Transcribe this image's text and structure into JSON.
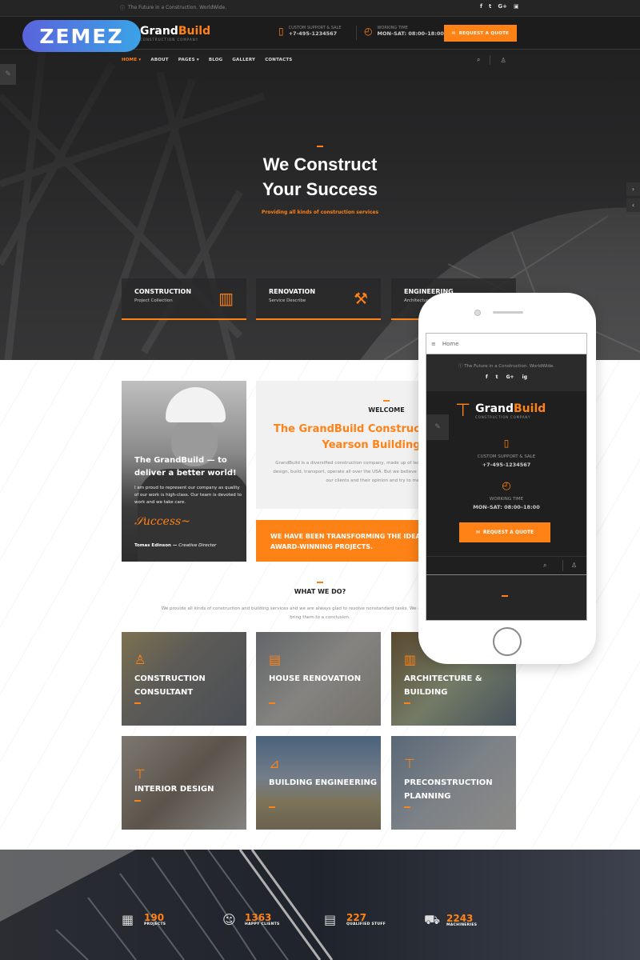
{
  "topbar": {
    "slogan": "The Future in a Construction. WorldWide.",
    "social": [
      "f",
      "t",
      "G+",
      "ig"
    ]
  },
  "brand": {
    "zemez": "ZEMEZ",
    "name_part1": "Grand",
    "name_part2": "Build",
    "subtitle": "CONSTRUCTION COMPANY"
  },
  "header": {
    "support_label": "CUSTOM SUPPORT & SALE",
    "support_value": "+7-495-1234567",
    "hours_label": "WORKING TIME",
    "hours_value": "MON–SAT: 08:00–18:00",
    "quote_button": "REQUEST A QUOTE"
  },
  "nav": {
    "items": [
      {
        "label": "HOME ▾",
        "active": true
      },
      {
        "label": "ABOUT",
        "active": false
      },
      {
        "label": "PAGES ▾",
        "active": false
      },
      {
        "label": "BLOG",
        "active": false
      },
      {
        "label": "GALLERY",
        "active": false
      },
      {
        "label": "CONTACTS",
        "active": false
      }
    ]
  },
  "hero": {
    "title_line1": "We Construct",
    "title_line2": "Your Success",
    "subtitle": "Providing all kinds of construction services",
    "features": [
      {
        "title": "CONSTRUCTION",
        "subtitle": "Project Collection",
        "icon": "building-icon"
      },
      {
        "title": "RENOVATION",
        "subtitle": "Service Describe",
        "icon": "tools-icon"
      },
      {
        "title": "ENGINEERING",
        "subtitle": "Architecture",
        "icon": "engineering-icon"
      }
    ]
  },
  "about": {
    "heading": "The GrandBuild — to deliver a better world!",
    "text": "I am proud to represent our company as quality of our work is high-class. Our team is devoted to work and we take care.",
    "signature": "Signature",
    "author_name": "Tomas Edinson",
    "author_role": "Creative Director"
  },
  "welcome": {
    "label": "WELCOME",
    "heading": "The GrandBuild Construction Company & Yearson Building Market",
    "text": "GrandBuild is a diversified construction company, made up of leaders in their industries. All working to design, build, transport, operate all over the USA. But we believe that projects are about more than that: our clients and their opinion and try to meet their needs.",
    "banner": "WE HAVE BEEN TRANSFORMING THE IDEAS & VISIONS INTO AWARD-WINNING PROJECTS."
  },
  "what_we_do": {
    "title": "WHAT WE DO?",
    "text": "We provide all kinds of construction and building services and we are always glad to resolve nonstandard tasks. We always take challenges and bring them to a conclusion.",
    "services": [
      {
        "title": "CONSTRUCTION CONSULTANT",
        "icon": "person-icon"
      },
      {
        "title": "HOUSE RENOVATION",
        "icon": "brick-icon"
      },
      {
        "title": "ARCHITECTURE & BUILDING",
        "icon": "building-icon"
      },
      {
        "title": "INTERIOR DESIGN",
        "icon": "paint-roller-icon"
      },
      {
        "title": "BUILDING ENGINEERING",
        "icon": "ruler-triangle-icon"
      },
      {
        "title": "PRECONSTRUCTION PLANNING",
        "icon": "t-square-icon"
      }
    ]
  },
  "stats": [
    {
      "value": "190",
      "label": "PROJECTS",
      "icon": "buildings-icon"
    },
    {
      "value": "1363",
      "label": "HAPPY CLIENTS",
      "icon": "users-icon"
    },
    {
      "value": "227",
      "label": "QUALIFIED STUFF",
      "icon": "certificate-icon"
    },
    {
      "value": "2243",
      "label": "MACHINERIES",
      "icon": "machinery-icon"
    }
  ],
  "phone": {
    "menu_label": "Home",
    "slogan": "The Future in a Construction. WorldWide.",
    "social": "f t G+ ig",
    "support_label": "CUSTOM SUPPORT & SALE",
    "support_value": "+7-495-1234567",
    "hours_label": "WORKING TIME",
    "hours_value": "MON–SAT: 08:00–18:00",
    "quote_button": "REQUEST A QUOTE"
  },
  "colors": {
    "accent": "#ff8216",
    "dark": "#1f1f1f"
  }
}
